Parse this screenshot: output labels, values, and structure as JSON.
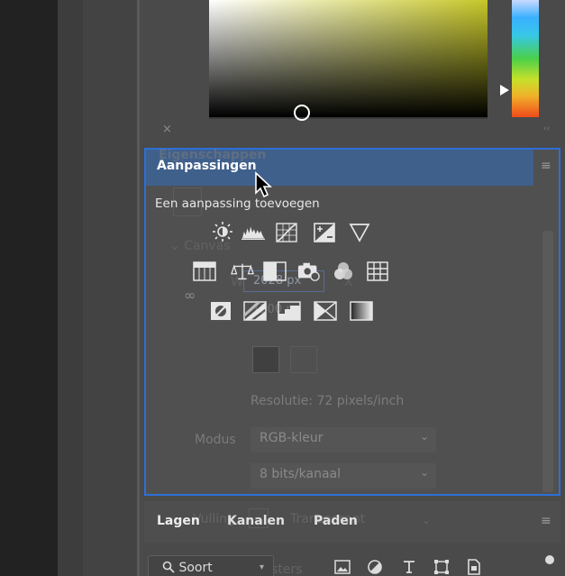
{
  "color_picker": {
    "field_colors": {
      "left": "#ffffff",
      "right": "#c7c729",
      "bottom": "#000000"
    },
    "hue_slider_colors": [
      "#c8d9ff",
      "#3ab0ff",
      "#4ad04a",
      "#c8e02a",
      "#f0b12a",
      "#f04a1a"
    ]
  },
  "panel_controls": {
    "close": "×",
    "collapse": "‹‹"
  },
  "ghost_properties": {
    "title": "Eigenschappen",
    "section": "Canvas",
    "width_value": "2028 px",
    "height_value": "1500 px",
    "w_label": "W",
    "x_label": "X",
    "resolution": "Resolutie: 72 pixels/inch",
    "modus_label": "Modus",
    "modus_value": "RGB-kleur",
    "bits_value": "8 bits/kanaal",
    "fill_label": "Vulling",
    "fill_value": "Transparant"
  },
  "adjustments": {
    "title": "Aanpassingen",
    "add_label": "Een aanpassing toevoegen",
    "row1": [
      "brightness-icon",
      "levels-icon",
      "curves-icon",
      "exposure-icon",
      "vibrance-icon"
    ],
    "row2": [
      "hue-saturation-icon",
      "color-balance-icon",
      "black-white-icon",
      "photo-filter-icon",
      "channel-mixer-icon",
      "color-lookup-icon"
    ],
    "row3": [
      "invert-icon",
      "posterize-icon",
      "threshold-icon",
      "selective-color-icon",
      "gradient-map-icon"
    ]
  },
  "layers": {
    "tabs": [
      "Lagen",
      "Kanalen",
      "Paden"
    ],
    "filter_label": "Soort",
    "ghost_kanalen": "Kanalen en rasters"
  },
  "accent_color": "#2d6fd6"
}
